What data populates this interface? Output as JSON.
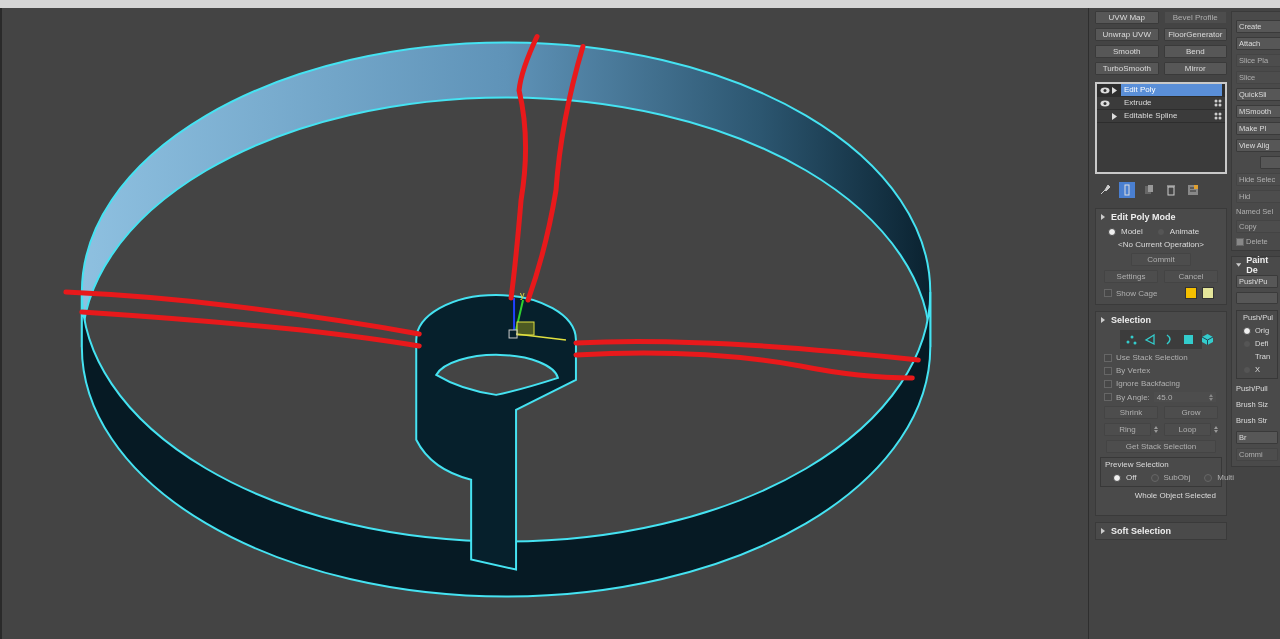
{
  "viewport": {
    "gizmo_axis_label": "y"
  },
  "modifier_buttons": [
    {
      "label": "UVW Map",
      "disabled": false
    },
    {
      "label": "Bevel Profile",
      "disabled": true
    },
    {
      "label": "Unwrap UVW",
      "disabled": false
    },
    {
      "label": "FloorGenerator",
      "disabled": false
    },
    {
      "label": "Smooth",
      "disabled": false
    },
    {
      "label": "Bend",
      "disabled": false
    },
    {
      "label": "TurboSmooth",
      "disabled": false
    },
    {
      "label": "Mirror",
      "disabled": false
    }
  ],
  "modifier_stack": [
    {
      "label": "Edit Poly",
      "selected": true,
      "eye": true,
      "expandable": true,
      "modifier_icon": false
    },
    {
      "label": "Extrude",
      "selected": false,
      "eye": true,
      "expandable": false,
      "modifier_icon": true
    },
    {
      "label": "Editable Spline",
      "selected": false,
      "eye": false,
      "expandable": true,
      "modifier_icon": true
    }
  ],
  "stack_toolbar": [
    {
      "kind": "pin",
      "selected": false
    },
    {
      "kind": "show-end",
      "selected": true
    },
    {
      "kind": "unique",
      "selected": false
    },
    {
      "kind": "remove",
      "selected": false
    },
    {
      "kind": "configure",
      "selected": false
    }
  ],
  "edit_poly_mode": {
    "title": "Edit Poly Mode",
    "modes": [
      {
        "label": "Model",
        "selected": true
      },
      {
        "label": "Animate",
        "selected": false
      }
    ],
    "operation": "<No Current Operation>",
    "commit": {
      "label": "Commit",
      "disabled": true
    },
    "buttons": [
      {
        "label": "Settings",
        "disabled": true
      },
      {
        "label": "Cancel",
        "disabled": true
      }
    ],
    "show_cage": {
      "label": "Show Cage",
      "checked": false,
      "disabled": true
    },
    "cage_colors": [
      {
        "color": "#f5c000"
      },
      {
        "color": "#e4e59a"
      }
    ]
  },
  "selection": {
    "title": "Selection",
    "levels": [
      {
        "kind": "vertex",
        "selected": false
      },
      {
        "kind": "edge",
        "selected": false
      },
      {
        "kind": "border",
        "selected": false
      },
      {
        "kind": "polygon",
        "selected": false
      },
      {
        "kind": "element",
        "selected": false
      }
    ],
    "options": [
      {
        "label": "Use Stack Selection",
        "checked": false,
        "disabled": true
      },
      {
        "label": "By Vertex",
        "checked": false,
        "disabled": true
      },
      {
        "label": "Ignore Backfacing",
        "checked": false,
        "disabled": true
      }
    ],
    "by_angle": {
      "label": "By Angle:",
      "value": "45.0",
      "checked": false,
      "disabled": true
    },
    "shrink_grow": [
      {
        "label": "Shrink",
        "disabled": true
      },
      {
        "label": "Grow",
        "disabled": true
      }
    ],
    "ring_loop": [
      {
        "label": "Ring",
        "disabled": true
      },
      {
        "label": "Loop",
        "disabled": true
      }
    ],
    "get_stack": {
      "label": "Get Stack Selection",
      "disabled": true
    },
    "preview": {
      "title": "Preview Selection",
      "options": [
        {
          "label": "Off",
          "selected": true,
          "disabled": false
        },
        {
          "label": "SubObj",
          "selected": false,
          "disabled": true
        },
        {
          "label": "Multi",
          "selected": false,
          "disabled": true
        }
      ]
    },
    "status": "Whole Object Selected"
  },
  "soft_selection": {
    "title": "Soft Selection",
    "expanded": false
  },
  "edit_geometry": [
    {
      "kind": "button",
      "label": "Create",
      "disabled": false
    },
    {
      "kind": "button",
      "label": "Attach",
      "disabled": false
    },
    {
      "kind": "button",
      "label": "Slice Pla",
      "disabled": true
    },
    {
      "kind": "button",
      "label": "Slice",
      "disabled": true
    },
    {
      "kind": "button",
      "label": "QuickSli",
      "disabled": false
    },
    {
      "kind": "button",
      "label": "MSmooth",
      "disabled": false
    },
    {
      "kind": "button",
      "label": "Make Pl",
      "disabled": false
    },
    {
      "kind": "button",
      "label": "View Alig",
      "disabled": false
    },
    {
      "kind": "blank"
    },
    {
      "kind": "button",
      "label": "Hide Selec",
      "disabled": true
    },
    {
      "kind": "button",
      "label": "Hid",
      "disabled": true
    },
    {
      "kind": "text",
      "label": "Named Sel",
      "disabled": true
    },
    {
      "kind": "button",
      "label": "Copy",
      "disabled": true
    },
    {
      "kind": "checkbox",
      "label": "Delete",
      "checked": true,
      "disabled": true
    }
  ],
  "paint_deformation": {
    "title": "Paint De",
    "top_buttons": [
      {
        "kind": "button",
        "label": "Push/Pu",
        "disabled": false
      },
      {
        "kind": "blank"
      }
    ],
    "group": {
      "title": "Push/Pul",
      "options": [
        {
          "kind": "radio",
          "label": "Orig",
          "selected": true
        },
        {
          "kind": "radio",
          "label": "Defi",
          "selected": false
        },
        {
          "kind": "text",
          "label": "Tran"
        },
        {
          "kind": "radio",
          "label": "X",
          "selected": false
        }
      ]
    },
    "labels": [
      "Push/Pull",
      "Brush Siz",
      "Brush Str"
    ],
    "bottom_buttons": [
      {
        "label": "Br",
        "disabled": false
      },
      {
        "label": "Commi",
        "disabled": true
      }
    ]
  }
}
